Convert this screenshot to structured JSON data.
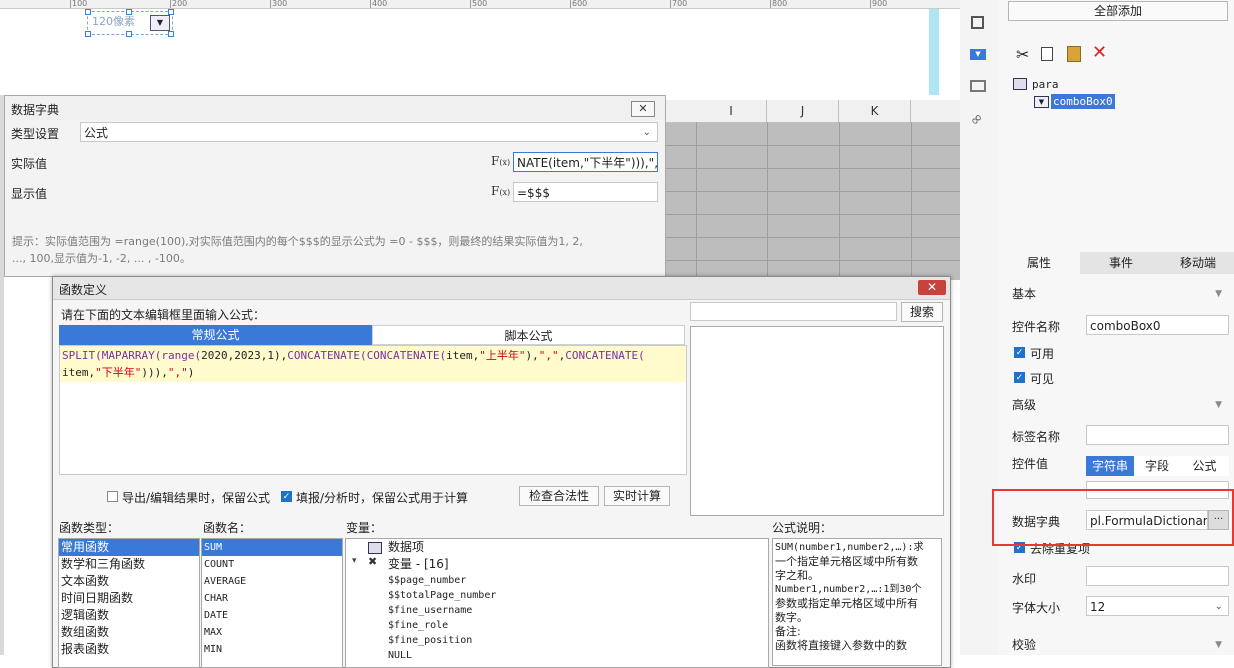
{
  "ruler": {
    "ticks": [
      "100",
      "200",
      "300",
      "400",
      "500",
      "600",
      "700",
      "800",
      "900"
    ]
  },
  "canvas": {
    "combo_preview": "120像素"
  },
  "sheet": {
    "columns": [
      "I",
      "J",
      "K"
    ]
  },
  "dict_dialog": {
    "title": "数据字典",
    "close": "✕",
    "type_label": "类型设置",
    "type_value": "公式",
    "actual_label": "实际值",
    "actual_value": "NATE(item,\"下半年\"))),\",\")",
    "display_label": "显示值",
    "display_value": "=$$$",
    "fx": "F",
    "fx_sub": "(x)",
    "hint_line1": "提示：实际值范围为 =range(100),对实际值范围内的每个$$$的显示公式为 =0 - $$$，则最终的结果实际值为1, 2,",
    "hint_line2": "..., 100,显示值为-1, -2, ... , -100。"
  },
  "func_dialog": {
    "title": "函数定义",
    "close": "✕",
    "prompt": "请在下面的文本编辑框里面输入公式：",
    "search_placeholder": "",
    "search_button": "搜索",
    "tab_normal": "常规公式",
    "tab_script": "脚本公式",
    "code_line1": [
      {
        "t": "SPLIT(",
        "c": "kw"
      },
      {
        "t": "MAPARRAY(",
        "c": "kw"
      },
      {
        "t": "range(",
        "c": "kw"
      },
      {
        "t": "2020,2023,1),",
        "c": "pl"
      },
      {
        "t": "CONCATENATE(",
        "c": "kw"
      },
      {
        "t": "CONCATENATE(",
        "c": "kw"
      },
      {
        "t": "item,",
        "c": "pl"
      },
      {
        "t": "\"上半年\"",
        "c": "str"
      },
      {
        "t": "),",
        "c": "pl"
      },
      {
        "t": "\",\"",
        "c": "str"
      },
      {
        "t": ",",
        "c": "pl"
      },
      {
        "t": "CONCATENATE(",
        "c": "kw"
      }
    ],
    "code_line2": [
      {
        "t": "item,",
        "c": "pl"
      },
      {
        "t": "\"下半年\"",
        "c": "str"
      },
      {
        "t": "))),",
        "c": "pl"
      },
      {
        "t": "\",\"",
        "c": "str"
      },
      {
        "t": ")",
        "c": "pl"
      }
    ],
    "opt_keep_export": "导出/编辑结果时，保留公式",
    "opt_keep_fill": "填报/分析时，保留公式用于计算",
    "btn_check": "检查合法性",
    "btn_realtime": "实时计算",
    "func_type_label": "函数类型：",
    "func_name_label": "函数名：",
    "var_label": "变量：",
    "desc_label": "公式说明：",
    "func_types": [
      "常用函数",
      "数学和三角函数",
      "文本函数",
      "时间日期函数",
      "逻辑函数",
      "数组函数",
      "报表函数"
    ],
    "func_names": [
      "SUM",
      "COUNT",
      "AVERAGE",
      "CHAR",
      "DATE",
      "MAX",
      "MIN"
    ],
    "var_root": "数据项",
    "var_group": "变量 - [16]",
    "vars": [
      "$$page_number",
      "$$totalPage_number",
      "$fine_username",
      "$fine_role",
      "$fine_position",
      "NULL"
    ],
    "desc_lines": [
      "SUM(number1,number2,…):求",
      "一个指定单元格区域中所有数",
      "字之和。",
      "Number1,number2,…:1到30个",
      "参数或指定单元格区域中所有",
      "数字。",
      "备注:",
      "函数将直接键入参数中的数"
    ]
  },
  "right_panel": {
    "add_all": "全部添加",
    "tree_root": "para",
    "tree_child": "comboBox0",
    "tabs": [
      "属性",
      "事件",
      "移动端"
    ],
    "basic": "基本",
    "widget_name_label": "控件名称",
    "widget_name_value": "comboBox0",
    "enabled": "可用",
    "visible": "可见",
    "advanced": "高级",
    "tag_name_label": "标签名称",
    "tag_name_value": "",
    "widget_value_label": "控件值",
    "seg": [
      "字符串",
      "字段",
      "公式"
    ],
    "dict_label": "数据字典",
    "dict_value": "pl.FormulaDictionary",
    "dict_btn": "···",
    "dedupe": "去除重复项",
    "watermark_label": "水印",
    "watermark_value": "",
    "font_size_label": "字体大小",
    "font_size_value": "12",
    "validate": "校验"
  },
  "colors": {
    "accent": "#3a79d8",
    "highlight": "#e53935",
    "close_red": "#c9423a",
    "delete_red": "#e02020"
  }
}
